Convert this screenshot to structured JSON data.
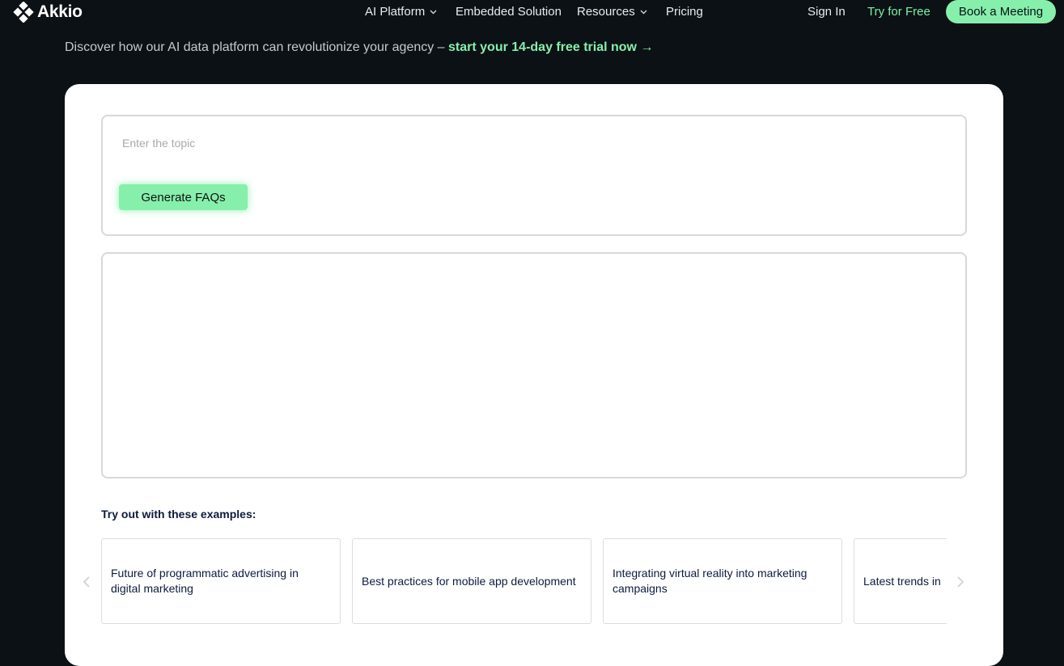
{
  "nav": {
    "logo_text": "Akkio",
    "items": [
      {
        "label": "AI Platform",
        "has_dropdown": true
      },
      {
        "label": "Embedded Solution",
        "has_dropdown": false
      },
      {
        "label": "Resources",
        "has_dropdown": true
      },
      {
        "label": "Pricing",
        "has_dropdown": false
      }
    ],
    "sign_in": "Sign In",
    "try_free": "Try for Free",
    "book_meeting": "Book a Meeting"
  },
  "hero": {
    "subline_text": "Discover how our AI data platform can revolutionize your agency – ",
    "subline_cta": "start your 14-day free trial now →"
  },
  "tool": {
    "topic_placeholder": "Enter the topic",
    "topic_value": "",
    "generate_label": "Generate FAQs",
    "examples_title": "Try out with these examples:",
    "examples": [
      "Future of programmatic advertising in digital marketing",
      "Best practices for mobile app development",
      "Integrating virtual reality into marketing campaigns",
      "Latest trends in"
    ]
  },
  "colors": {
    "background": "#0b1114",
    "accent": "#86efac",
    "card": "#ffffff",
    "text_dark": "#0d1b3e"
  },
  "icons": {
    "logo": "akkio-logo-icon",
    "dropdown": "chevron-down-icon",
    "carousel_prev": "chevron-left-icon",
    "carousel_next": "chevron-right-icon"
  }
}
